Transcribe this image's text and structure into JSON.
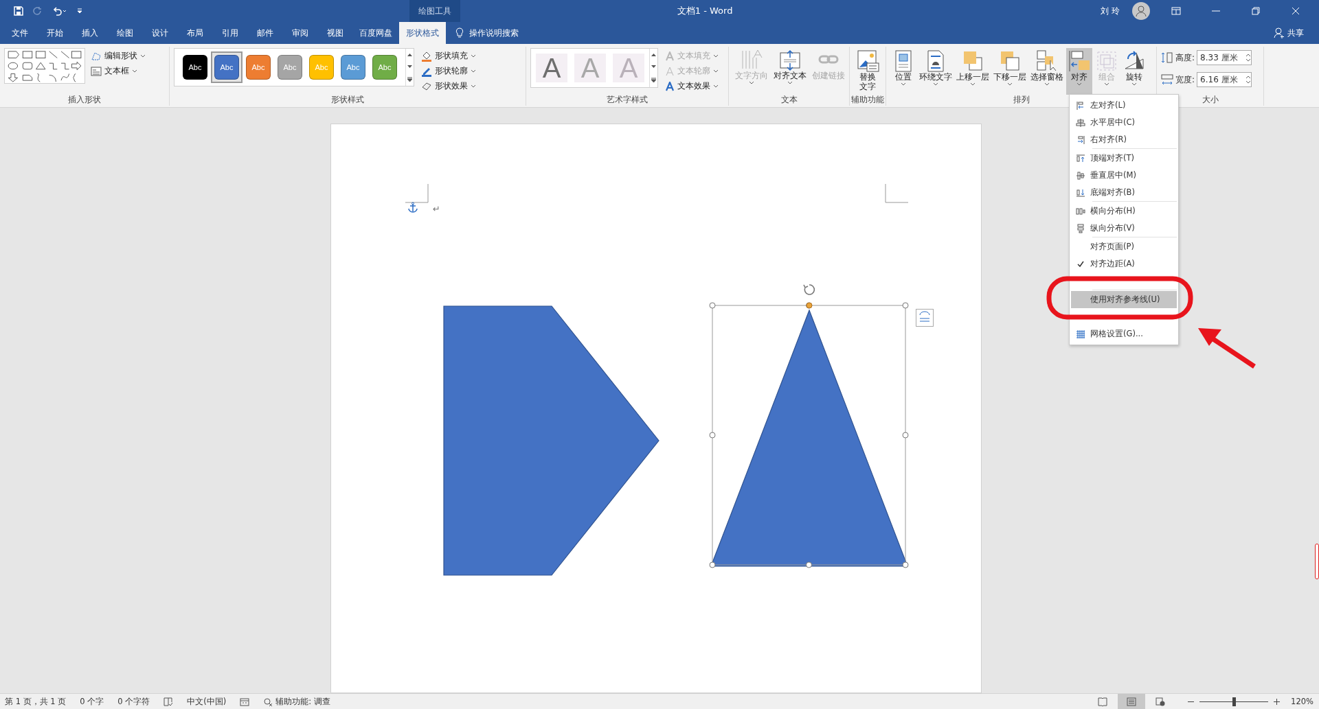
{
  "window": {
    "title": "文档1  -  Word",
    "contextual_label": "绘图工具",
    "user": "刘 玲"
  },
  "tabs": [
    {
      "label": "文件",
      "selected": false
    },
    {
      "label": "开始",
      "selected": false
    },
    {
      "label": "插入",
      "selected": false
    },
    {
      "label": "绘图",
      "selected": false
    },
    {
      "label": "设计",
      "selected": false
    },
    {
      "label": "布局",
      "selected": false
    },
    {
      "label": "引用",
      "selected": false
    },
    {
      "label": "邮件",
      "selected": false
    },
    {
      "label": "审阅",
      "selected": false
    },
    {
      "label": "视图",
      "selected": false
    },
    {
      "label": "百度网盘",
      "selected": false
    },
    {
      "label": "形状格式",
      "selected": true
    }
  ],
  "tell_me": "操作说明搜索",
  "share": "共享",
  "ribbon": {
    "insert_shapes": {
      "label": "插入形状",
      "commands": [
        {
          "label": "编辑形状",
          "kind": "edit"
        },
        {
          "label": "文本框",
          "kind": "textbox"
        }
      ]
    },
    "shape_styles": {
      "label": "形状样式",
      "swatches": [
        {
          "label": "Abc",
          "color": "#000000",
          "selected": false
        },
        {
          "label": "Abc",
          "color": "#4472c4",
          "selected": true
        },
        {
          "label": "Abc",
          "color": "#ed7d31",
          "selected": false
        },
        {
          "label": "Abc",
          "color": "#a5a5a5",
          "selected": false
        },
        {
          "label": "Abc",
          "color": "#ffc000",
          "selected": false
        },
        {
          "label": "Abc",
          "color": "#5b9bd5",
          "selected": false
        },
        {
          "label": "Abc",
          "color": "#70ad47",
          "selected": false
        }
      ],
      "commands": [
        {
          "label": "形状填充",
          "kind": "fill"
        },
        {
          "label": "形状轮廓",
          "kind": "outline"
        },
        {
          "label": "形状效果",
          "kind": "effects"
        }
      ]
    },
    "wordart": {
      "label": "艺术字样式",
      "samples": [
        {
          "label": "A",
          "color": "#6e6e6e"
        },
        {
          "label": "A",
          "color": "#a8a8a8"
        },
        {
          "label": "A",
          "color": "#b9b1b9"
        }
      ],
      "commands": [
        {
          "label": "文本填充",
          "kind": "fill",
          "disabled": true
        },
        {
          "label": "文本轮廓",
          "kind": "outline",
          "disabled": true
        },
        {
          "label": "文本效果",
          "kind": "effects",
          "disabled": false
        }
      ]
    },
    "text": {
      "label": "文本",
      "buttons": [
        {
          "label": "文字方向",
          "kind": "direction",
          "disabled": true
        },
        {
          "label": "对齐文本",
          "kind": "align-text",
          "disabled": false
        },
        {
          "label": "创建链接",
          "kind": "link",
          "disabled": true
        }
      ]
    },
    "accessibility": {
      "label": "辅助功能",
      "buttons": [
        {
          "label": "替换文字",
          "kind": "alt-text",
          "disabled": false
        }
      ]
    },
    "arrange": {
      "label": "排列",
      "buttons": [
        {
          "label": "位置",
          "kind": "position",
          "disabled": false,
          "selected": false
        },
        {
          "label": "环绕文字",
          "kind": "wrap",
          "disabled": false,
          "selected": false
        },
        {
          "label": "上移一层",
          "kind": "forward",
          "disabled": false,
          "selected": false
        },
        {
          "label": "下移一层",
          "kind": "backward",
          "disabled": false,
          "selected": false
        },
        {
          "label": "选择窗格",
          "kind": "pane",
          "disabled": false,
          "selected": false
        },
        {
          "label": "对齐",
          "kind": "align",
          "disabled": false,
          "selected": true
        },
        {
          "label": "组合",
          "kind": "group",
          "disabled": true,
          "selected": false
        },
        {
          "label": "旋转",
          "kind": "rotate",
          "disabled": false,
          "selected": false
        }
      ]
    },
    "size": {
      "label": "大小",
      "fields": [
        {
          "label": "高度:",
          "value": "8.33 厘米",
          "kind": "height"
        },
        {
          "label": "宽度:",
          "value": "6.16 厘米",
          "kind": "width"
        }
      ]
    }
  },
  "align_menu": {
    "groups": [
      [
        {
          "label": "左对齐(L)",
          "kind": "left",
          "checked": false,
          "selected": false
        },
        {
          "label": "水平居中(C)",
          "kind": "hcenter",
          "checked": false,
          "selected": false
        },
        {
          "label": "右对齐(R)",
          "kind": "right",
          "checked": false,
          "selected": false
        }
      ],
      [
        {
          "label": "顶端对齐(T)",
          "kind": "top",
          "checked": false,
          "selected": false
        },
        {
          "label": "垂直居中(M)",
          "kind": "vcenter",
          "checked": false,
          "selected": false
        },
        {
          "label": "底端对齐(B)",
          "kind": "bottom",
          "checked": false,
          "selected": false
        }
      ],
      [
        {
          "label": "横向分布(H)",
          "kind": "hdist",
          "checked": false,
          "selected": false
        },
        {
          "label": "纵向分布(V)",
          "kind": "vdist",
          "checked": false,
          "selected": false
        }
      ],
      [
        {
          "label": "对齐页面(P)",
          "kind": "plain",
          "checked": false,
          "selected": false
        },
        {
          "label": "对齐边距(A)",
          "kind": "plain",
          "checked": true,
          "selected": false
        },
        {
          "kind": "obscured"
        }
      ],
      [
        {
          "label": "使用对齐参考线(U)",
          "kind": "plain",
          "checked": false,
          "selected": true
        },
        {
          "kind": "obscured"
        },
        {
          "label": "网格设置(G)...",
          "kind": "grid",
          "checked": false,
          "selected": false
        }
      ]
    ]
  },
  "document": {
    "paragraph_mark": "↵",
    "shapes": [
      {
        "kind": "pentagon",
        "selected": false
      },
      {
        "kind": "triangle",
        "selected": true
      }
    ]
  },
  "status_bar": {
    "page": "第 1 页，共 1 页",
    "words": "0 个字",
    "chars": "0 个字符",
    "language": "中文(中国)",
    "accessibility": "辅助功能: 调查",
    "views": [
      {
        "kind": "read",
        "selected": false
      },
      {
        "kind": "print",
        "selected": true
      },
      {
        "kind": "web",
        "selected": false
      }
    ],
    "zoom": {
      "level": 0.5,
      "reading": "120%"
    }
  }
}
